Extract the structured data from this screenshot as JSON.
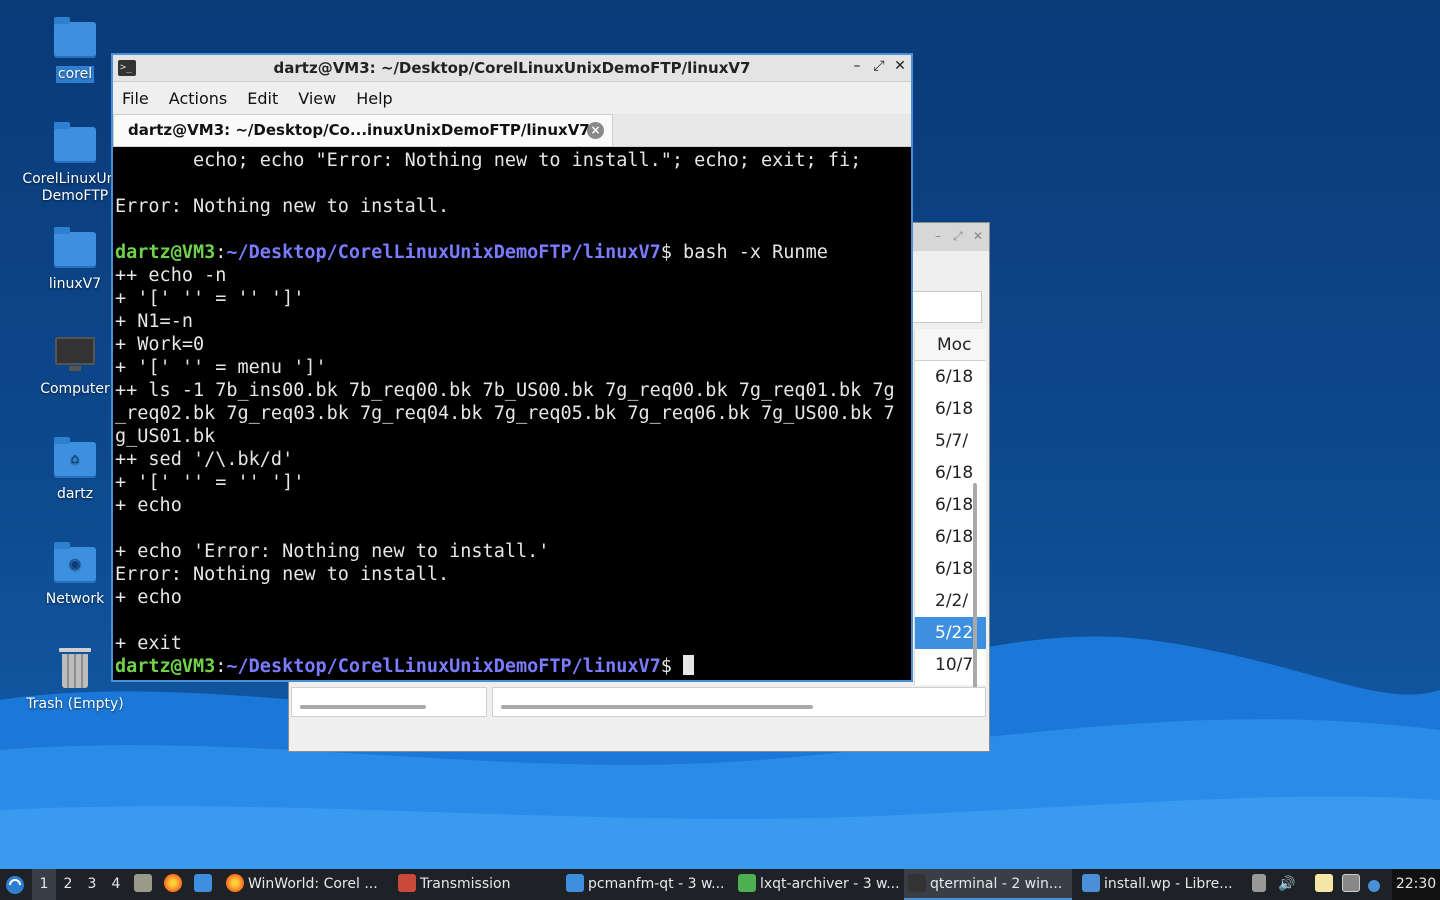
{
  "desktop": {
    "icons": [
      {
        "label": "corel",
        "kind": "folder",
        "selected": true
      },
      {
        "label": "CorelLinuxUnixDemoFTP",
        "kind": "folder"
      },
      {
        "label": "linuxV7",
        "kind": "folder"
      },
      {
        "label": "Computer",
        "kind": "computer"
      },
      {
        "label": "dartz",
        "kind": "home-folder"
      },
      {
        "label": "Network",
        "kind": "network-folder"
      },
      {
        "label": "Trash (Empty)",
        "kind": "trash"
      }
    ]
  },
  "back_window": {
    "column_header": "Moc",
    "rows": [
      "6/18",
      "6/18",
      "5/7/",
      "6/18",
      "6/18",
      "6/18",
      "6/18",
      "2/2/",
      "5/22",
      "10/7"
    ],
    "selected_row_index": 8
  },
  "terminal": {
    "title": "dartz@VM3: ~/Desktop/CorelLinuxUnixDemoFTP/linuxV7",
    "menu": [
      "File",
      "Actions",
      "Edit",
      "View",
      "Help"
    ],
    "tab_label": "dartz@VM3: ~/Desktop/Co...inuxUnixDemoFTP/linuxV7",
    "prompt_user": "dartz@VM3",
    "prompt_path": "~/Desktop/CorelLinuxUnixDemoFTP/linuxV7",
    "lines": [
      "       echo; echo \"Error: Nothing new to install.\"; echo; exit; fi;",
      "",
      "Error: Nothing new to install.",
      "",
      "++ echo -n",
      "+ '[' '' = '' ']'",
      "+ N1=-n",
      "+ Work=0",
      "+ '[' '' = menu ']'",
      "++ ls -1 7b_ins00.bk 7b_req00.bk 7b_US00.bk 7g_req00.bk 7g_req01.bk 7g",
      "_req02.bk 7g_req03.bk 7g_req04.bk 7g_req05.bk 7g_req06.bk 7g_US00.bk 7",
      "g_US01.bk",
      "++ sed '/\\.bk/d'",
      "+ '[' '' = '' ']'",
      "+ echo",
      "",
      "+ echo 'Error: Nothing new to install.'",
      "Error: Nothing new to install.",
      "+ echo",
      "",
      "+ exit"
    ],
    "command": "bash -x Runme"
  },
  "taskbar": {
    "desktops": [
      "1",
      "2",
      "3",
      "4"
    ],
    "active_desktop": "1",
    "tasks": [
      {
        "label": "WinWorld: Corel ...",
        "icon": "firefox-icon"
      },
      {
        "label": "Transmission",
        "icon": "transmission-icon"
      },
      {
        "label": "pcmanfm-qt - 3 w...",
        "icon": "folder-icon"
      },
      {
        "label": "lxqt-archiver - 3 w...",
        "icon": "archiver-icon"
      },
      {
        "label": "qterminal - 2 win...",
        "icon": "terminal-icon",
        "active": true
      },
      {
        "label": "install.wp - Libre...",
        "icon": "document-icon"
      }
    ],
    "clock": "22:30"
  }
}
